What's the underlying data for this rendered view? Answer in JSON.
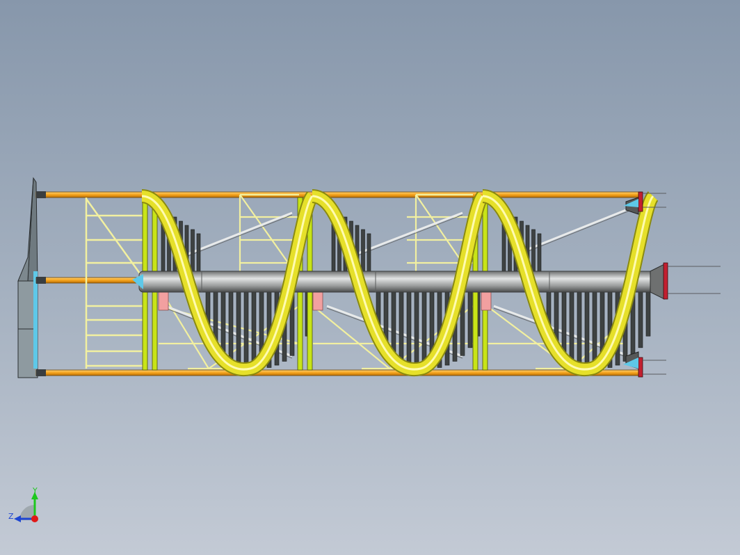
{
  "viewport": {
    "background_top": "#8797ab",
    "background_bottom": "#c3cad5"
  },
  "model": {
    "colors": {
      "rail": "#f4a21b",
      "helix": "#e6e02a",
      "helix_edge": "#8a8a10",
      "lattice": "#f2f0a0",
      "post": "#c8e418",
      "slat": "#3e4242",
      "shaft": "#9a9c9c",
      "shaft_highlight": "#e2e4e4",
      "end_plate": "#8e9aa0",
      "bracket": "#4fc3e6",
      "pad": "#f2a0a0"
    },
    "helix_turns": 3
  },
  "triad": {
    "y_label": "Y",
    "z_label": "Z",
    "y_color": "#1ec81e",
    "z_color": "#1e46d2",
    "x_color": "#e01818"
  }
}
